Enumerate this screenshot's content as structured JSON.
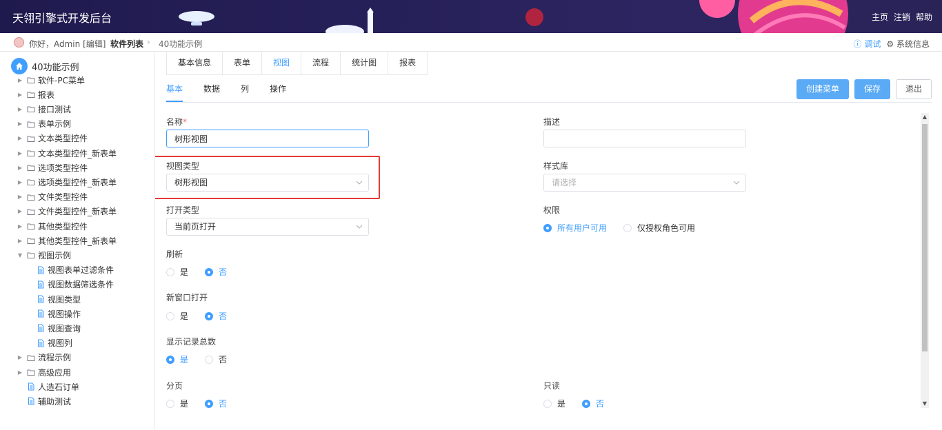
{
  "header": {
    "title": "天翎引擎式开发后台",
    "nav": [
      "主页",
      "注销",
      "帮助"
    ]
  },
  "breadcrumb": {
    "greeting": "你好，Admin",
    "edit": "[编辑]",
    "item1": "软件列表",
    "item2": "40功能示例",
    "debug": "调试",
    "sysinfo": "系统信息"
  },
  "tree": {
    "root": "40功能示例",
    "items": [
      {
        "label": "软件-PC菜单",
        "type": "folder"
      },
      {
        "label": "报表",
        "type": "folder"
      },
      {
        "label": "接口测试",
        "type": "folder"
      },
      {
        "label": "表单示例",
        "type": "folder"
      },
      {
        "label": "文本类型控件",
        "type": "folder"
      },
      {
        "label": "文本类型控件_新表单",
        "type": "folder"
      },
      {
        "label": "选项类型控件",
        "type": "folder"
      },
      {
        "label": "选项类型控件_新表单",
        "type": "folder"
      },
      {
        "label": "文件类型控件",
        "type": "folder"
      },
      {
        "label": "文件类型控件_新表单",
        "type": "folder"
      },
      {
        "label": "其他类型控件",
        "type": "folder"
      },
      {
        "label": "其他类型控件_新表单",
        "type": "folder"
      },
      {
        "label": "视图示例",
        "type": "folder-open"
      },
      {
        "label": "视图表单过滤条件",
        "type": "file"
      },
      {
        "label": "视图数据筛选条件",
        "type": "file"
      },
      {
        "label": "视图类型",
        "type": "file"
      },
      {
        "label": "视图操作",
        "type": "file"
      },
      {
        "label": "视图查询",
        "type": "file"
      },
      {
        "label": "视图列",
        "type": "file"
      },
      {
        "label": "流程示例",
        "type": "folder"
      },
      {
        "label": "高级应用",
        "type": "folder"
      },
      {
        "label": "人造石订单",
        "type": "file"
      },
      {
        "label": "辅助测试",
        "type": "file"
      }
    ]
  },
  "top_tabs": [
    "基本信息",
    "表单",
    "视图",
    "流程",
    "统计图",
    "报表"
  ],
  "sub_tabs": [
    "基本",
    "数据",
    "列",
    "操作"
  ],
  "actions": {
    "create_menu": "创建菜单",
    "save": "保存",
    "exit": "退出"
  },
  "form": {
    "name_label": "名称",
    "name_required": "*",
    "name_value": "树形视图",
    "desc_label": "描述",
    "desc_value": "",
    "view_type_label": "视图类型",
    "view_type_value": "树形视图",
    "style_label": "样式库",
    "style_placeholder": "请选择",
    "open_type_label": "打开类型",
    "open_type_value": "当前页打开",
    "permission_label": "权限",
    "permission_options": [
      "所有用户可用",
      "仅授权角色可用"
    ],
    "refresh_label": "刷新",
    "new_window_label": "新窗口打开",
    "show_count_label": "显示记录总数",
    "paging_label": "分页",
    "readonly_label": "只读",
    "yes": "是",
    "no": "否"
  }
}
